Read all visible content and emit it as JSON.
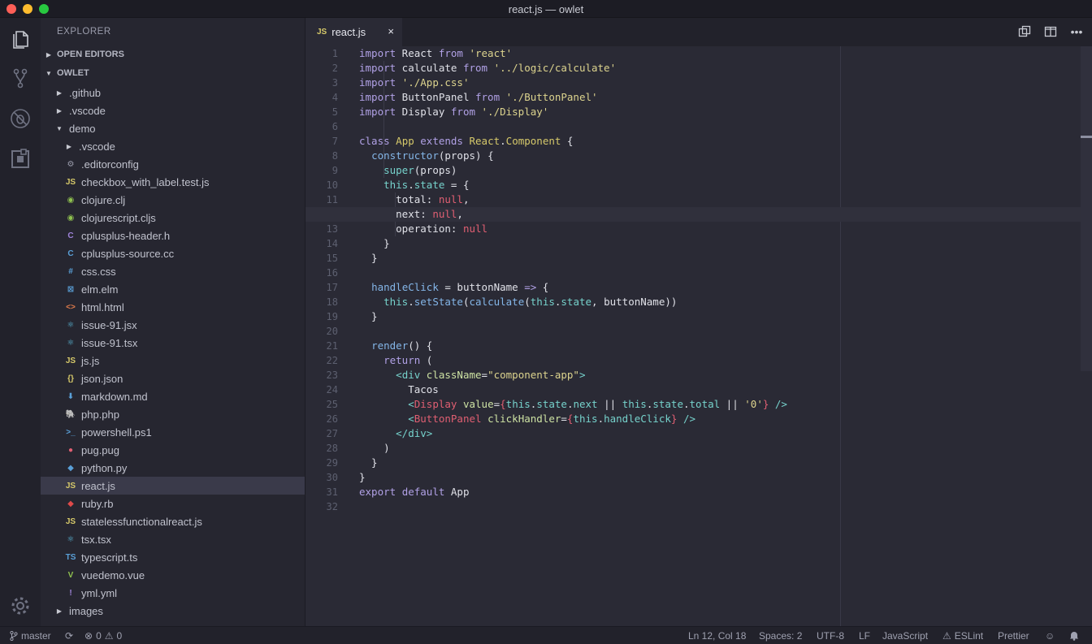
{
  "window": {
    "title": "react.js — owlet"
  },
  "sidebar": {
    "title": "EXPLORER",
    "open_editors": "OPEN EDITORS",
    "project": "OWLET",
    "items": [
      {
        "label": ".github",
        "kind": "folder",
        "depth": 0,
        "icon": "chevron-right"
      },
      {
        "label": ".vscode",
        "kind": "folder",
        "depth": 0,
        "icon": "chevron-right"
      },
      {
        "label": "demo",
        "kind": "folder-open",
        "depth": 0,
        "icon": "chevron-down"
      },
      {
        "label": ".vscode",
        "kind": "folder",
        "depth": 1,
        "icon": "chevron-right"
      },
      {
        "label": ".editorconfig",
        "kind": "file",
        "depth": 1,
        "icon": "gear",
        "glyph": "⚙",
        "color": "#9a9cab"
      },
      {
        "label": "checkbox_with_label.test.js",
        "kind": "file",
        "depth": 1,
        "glyph": "JS",
        "color": "#d6c96a"
      },
      {
        "label": "clojure.clj",
        "kind": "file",
        "depth": 1,
        "glyph": "◉",
        "color": "#8fc14f"
      },
      {
        "label": "clojurescript.cljs",
        "kind": "file",
        "depth": 1,
        "glyph": "◉",
        "color": "#8fc14f"
      },
      {
        "label": "cplusplus-header.h",
        "kind": "file",
        "depth": 1,
        "glyph": "C",
        "color": "#a084dc"
      },
      {
        "label": "cplusplus-source.cc",
        "kind": "file",
        "depth": 1,
        "glyph": "C",
        "color": "#5aa0d8"
      },
      {
        "label": "css.css",
        "kind": "file",
        "depth": 1,
        "glyph": "#",
        "color": "#5aa0d8"
      },
      {
        "label": "elm.elm",
        "kind": "file",
        "depth": 1,
        "glyph": "⊠",
        "color": "#5aa0d8"
      },
      {
        "label": "html.html",
        "kind": "file",
        "depth": 1,
        "glyph": "<>",
        "color": "#e07b4a"
      },
      {
        "label": "issue-91.jsx",
        "kind": "file",
        "depth": 1,
        "glyph": "⚛",
        "color": "#5ab8d8"
      },
      {
        "label": "issue-91.tsx",
        "kind": "file",
        "depth": 1,
        "glyph": "⚛",
        "color": "#5ab8d8"
      },
      {
        "label": "js.js",
        "kind": "file",
        "depth": 1,
        "glyph": "JS",
        "color": "#d6c96a"
      },
      {
        "label": "json.json",
        "kind": "file",
        "depth": 1,
        "glyph": "{}",
        "color": "#d6c96a"
      },
      {
        "label": "markdown.md",
        "kind": "file",
        "depth": 1,
        "glyph": "⬇",
        "color": "#5aa0d8"
      },
      {
        "label": "php.php",
        "kind": "file",
        "depth": 1,
        "glyph": "🐘",
        "color": "#a084dc"
      },
      {
        "label": "powershell.ps1",
        "kind": "file",
        "depth": 1,
        "glyph": ">_",
        "color": "#5aa0d8"
      },
      {
        "label": "pug.pug",
        "kind": "file",
        "depth": 1,
        "glyph": "●",
        "color": "#e05f72"
      },
      {
        "label": "python.py",
        "kind": "file",
        "depth": 1,
        "glyph": "◆",
        "color": "#5aa0d8"
      },
      {
        "label": "react.js",
        "kind": "file",
        "depth": 1,
        "glyph": "JS",
        "color": "#d6c96a",
        "selected": true
      },
      {
        "label": "ruby.rb",
        "kind": "file",
        "depth": 1,
        "glyph": "◆",
        "color": "#e04a4a"
      },
      {
        "label": "statelessfunctionalreact.js",
        "kind": "file",
        "depth": 1,
        "glyph": "JS",
        "color": "#d6c96a"
      },
      {
        "label": "tsx.tsx",
        "kind": "file",
        "depth": 1,
        "glyph": "⚛",
        "color": "#5ab8d8"
      },
      {
        "label": "typescript.ts",
        "kind": "file",
        "depth": 1,
        "glyph": "TS",
        "color": "#5aa0d8"
      },
      {
        "label": "vuedemo.vue",
        "kind": "file",
        "depth": 1,
        "glyph": "V",
        "color": "#8fc14f"
      },
      {
        "label": "yml.yml",
        "kind": "file",
        "depth": 1,
        "glyph": "!",
        "color": "#a084dc"
      },
      {
        "label": "images",
        "kind": "folder",
        "depth": 0,
        "icon": "chevron-right"
      }
    ]
  },
  "tabs": [
    {
      "label": "react.js",
      "badge": "JS",
      "close": "×"
    }
  ],
  "editor": {
    "active_line": 12,
    "lines": [
      "import React from 'react'",
      "import calculate from '../logic/calculate'",
      "import './App.css'",
      "import ButtonPanel from './ButtonPanel'",
      "import Display from './Display'",
      "",
      "class App extends React.Component {",
      "  constructor(props) {",
      "    super(props)",
      "    this.state = {",
      "      total: null,",
      "      next: null,",
      "      operation: null",
      "    }",
      "  }",
      "",
      "  handleClick = buttonName => {",
      "    this.setState(calculate(this.state, buttonName))",
      "  }",
      "",
      "  render() {",
      "    return (",
      "      <div className=\"component-app\">",
      "        Tacos",
      "        <Display value={this.state.next || this.state.total || '0'} />",
      "        <ButtonPanel clickHandler={this.handleClick} />",
      "      </div>",
      "    )",
      "  }",
      "}",
      "export default App",
      ""
    ]
  },
  "status": {
    "branch": "master",
    "errors": "0",
    "warnings": "0",
    "position": "Ln 12, Col 18",
    "spaces": "Spaces: 2",
    "encoding": "UTF-8",
    "eol": "LF",
    "language": "JavaScript",
    "eslint": "ESLint",
    "prettier": "Prettier"
  },
  "colors": {
    "keyword": "#b1a1e6",
    "string": "#ddd48e",
    "class": "#d6c96a",
    "function": "#84b6e8",
    "this": "#76d2cc",
    "null": "#e05f72"
  }
}
